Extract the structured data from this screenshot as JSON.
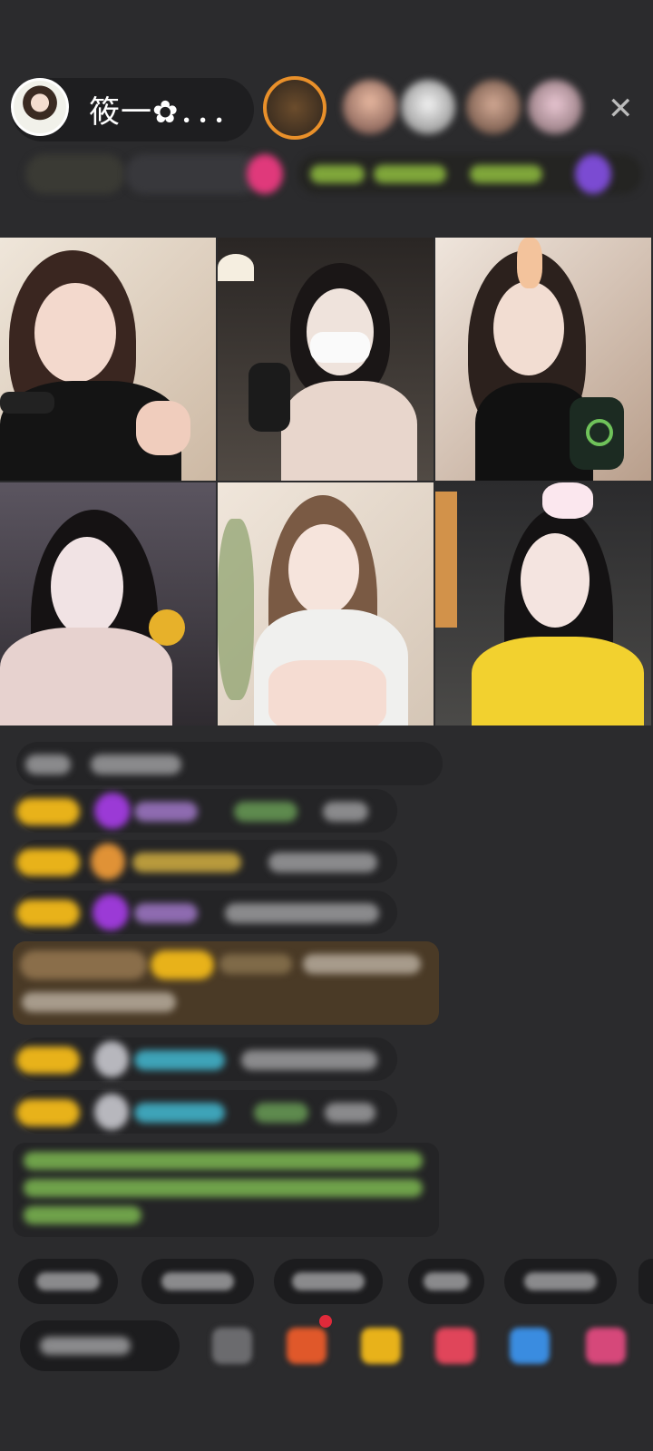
{
  "host": {
    "name": "筱一✿．．．"
  },
  "colors": {
    "background": "#2b2b2d",
    "badge_gold": "#e8b21a",
    "chat_bubble": "#242426",
    "system_msg_green": "#8bd16a"
  },
  "icons": {
    "close": "close-icon"
  }
}
